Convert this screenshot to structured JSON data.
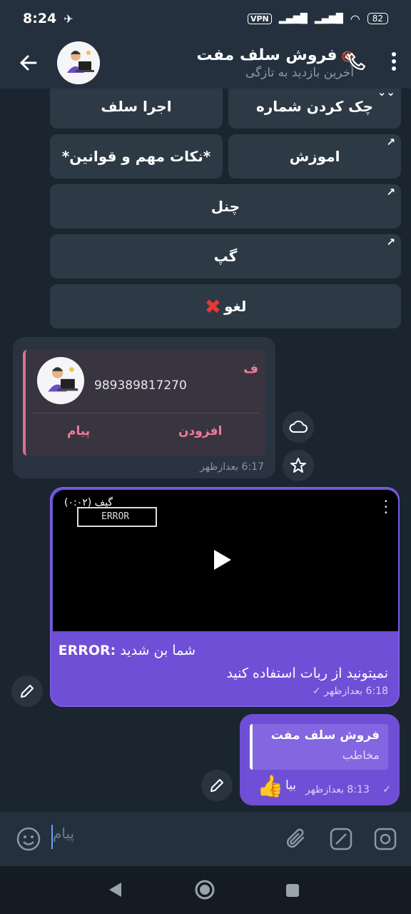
{
  "status_bar": {
    "time": "8:24",
    "vpn": "VPN",
    "battery": "82"
  },
  "header": {
    "title": "فروش سلف مفت",
    "subtitle": "آخرین بازدید به تازگی"
  },
  "keyboard": {
    "row1": [
      "اجرا سلف",
      "چک کردن شماره"
    ],
    "row2": [
      "*نکات مهم و قوانین*",
      "اموزش"
    ],
    "row3": "چنل",
    "row4": "گپ",
    "row5": "لغو"
  },
  "contact_message": {
    "name": "ف",
    "phone": "989389817270",
    "add_label": "افزودن",
    "message_label": "پیام",
    "time": "6:17 بعدازظهر"
  },
  "gif_message": {
    "gif_label": "گیف (۰:۰۲)",
    "error_text": "ERROR",
    "line1_bold": "ERROR:",
    "line1_text": " شما بن شدید",
    "line2": "نمیتونید از ربات استفاده کنید",
    "time": "6:18 بعدازظهر"
  },
  "reply_message": {
    "quote_title": "فروش سلف مفت",
    "quote_sub": "مخاطب",
    "text": "بیا",
    "time": "8:13 بعدازظهر"
  },
  "composer": {
    "placeholder": "پیام"
  },
  "colors": {
    "bubble_out": "#6f4fd6",
    "accent_pink": "#ef7a9c",
    "bg": "#1a2530"
  }
}
